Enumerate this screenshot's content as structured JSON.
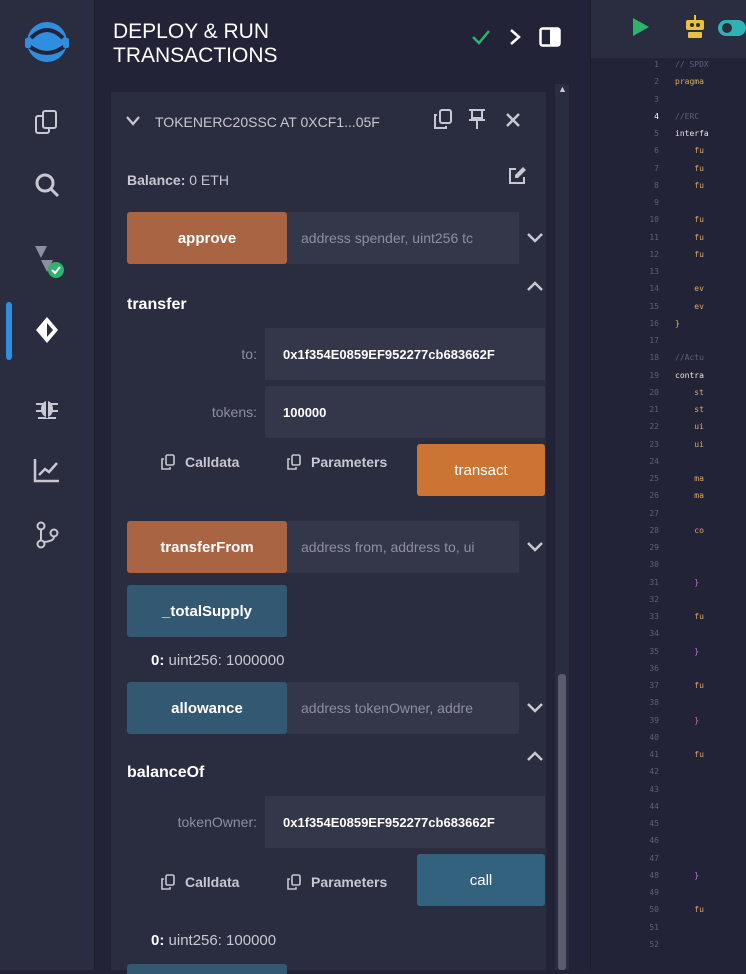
{
  "panel": {
    "title": "DEPLOY & RUN\nTRANSACTIONS"
  },
  "contract": {
    "name": "TOKENERC20SSC AT 0XCF1...05F",
    "balance_label": "Balance:",
    "balance_value": "0 ETH"
  },
  "functions": {
    "approve": {
      "label": "approve",
      "placeholder": "address spender, uint256 tc"
    },
    "transfer": {
      "title": "transfer",
      "to_label": "to:",
      "to_value": "0x1f354E0859EF952277cb683662F",
      "tokens_label": "tokens:",
      "tokens_value": "100000",
      "calldata_label": "Calldata",
      "parameters_label": "Parameters",
      "action_label": "transact"
    },
    "transferFrom": {
      "label": "transferFrom",
      "placeholder": "address from, address to, ui"
    },
    "totalSupply": {
      "label": "_totalSupply",
      "result_index": "0:",
      "result_value": "uint256: 1000000"
    },
    "allowance": {
      "label": "allowance",
      "placeholder": "address tokenOwner, addre"
    },
    "balanceOf": {
      "title": "balanceOf",
      "owner_label": "tokenOwner:",
      "owner_value": "0x1f354E0859EF952277cb683662F",
      "calldata_label": "Calldata",
      "parameters_label": "Parameters",
      "action_label": "call",
      "result_index": "0:",
      "result_value": "uint256: 100000"
    }
  },
  "editor": {
    "line_numbers": [
      "1",
      "2",
      "3",
      "4",
      "5",
      "6",
      "7",
      "8",
      "9",
      "10",
      "11",
      "12",
      "13",
      "14",
      "15",
      "16",
      "17",
      "18",
      "19",
      "20",
      "21",
      "22",
      "23",
      "24",
      "25",
      "26",
      "27",
      "28",
      "29",
      "30",
      "31",
      "32",
      "33",
      "34",
      "35",
      "36",
      "37",
      "38",
      "39",
      "40",
      "41",
      "42",
      "43",
      "44",
      "45",
      "46",
      "47",
      "48",
      "49",
      "50",
      "51",
      "52"
    ],
    "code_lines": [
      {
        "line": 1,
        "text": "// SPDX",
        "color": "#5d6178"
      },
      {
        "line": 2,
        "text": "pragma",
        "color": "#e0a95e"
      },
      {
        "line": 4,
        "text": "//ERC",
        "color": "#5d6178"
      },
      {
        "line": 5,
        "text": "interfa",
        "color": "#e8e8e8"
      },
      {
        "line": 6,
        "text": "    fu",
        "color": "#e0a95e"
      },
      {
        "line": 7,
        "text": "    fu",
        "color": "#e0a95e"
      },
      {
        "line": 8,
        "text": "    fu",
        "color": "#e0a95e"
      },
      {
        "line": 10,
        "text": "    fu",
        "color": "#e0a95e"
      },
      {
        "line": 11,
        "text": "    fu",
        "color": "#e0a95e"
      },
      {
        "line": 12,
        "text": "    fu",
        "color": "#e0a95e"
      },
      {
        "line": 14,
        "text": "    ev",
        "color": "#e0a95e"
      },
      {
        "line": 15,
        "text": "    ev",
        "color": "#e0a95e"
      },
      {
        "line": 16,
        "text": "}",
        "color": "#e8c13d"
      },
      {
        "line": 18,
        "text": "//Actu",
        "color": "#5d6178"
      },
      {
        "line": 19,
        "text": "contra",
        "color": "#e8e8e8"
      },
      {
        "line": 20,
        "text": "    st",
        "color": "#e0a95e"
      },
      {
        "line": 21,
        "text": "    st",
        "color": "#e0a95e"
      },
      {
        "line": 22,
        "text": "    ui",
        "color": "#e0a95e"
      },
      {
        "line": 23,
        "text": "    ui",
        "color": "#e0a95e"
      },
      {
        "line": 25,
        "text": "    ma",
        "color": "#e0a95e"
      },
      {
        "line": 26,
        "text": "    ma",
        "color": "#e0a95e"
      },
      {
        "line": 28,
        "text": "    co",
        "color": "#e0a95e"
      },
      {
        "line": 31,
        "text": "    }",
        "color": "#c878c8"
      },
      {
        "line": 33,
        "text": "    fu",
        "color": "#e0a95e"
      },
      {
        "line": 35,
        "text": "    }",
        "color": "#c878c8"
      },
      {
        "line": 37,
        "text": "    fu",
        "color": "#e0a95e"
      },
      {
        "line": 39,
        "text": "    }",
        "color": "#c878c8"
      },
      {
        "line": 41,
        "text": "    fu",
        "color": "#e0a95e"
      },
      {
        "line": 48,
        "text": "    }",
        "color": "#c878c8"
      },
      {
        "line": 50,
        "text": "    fu",
        "color": "#e0a95e"
      }
    ]
  }
}
